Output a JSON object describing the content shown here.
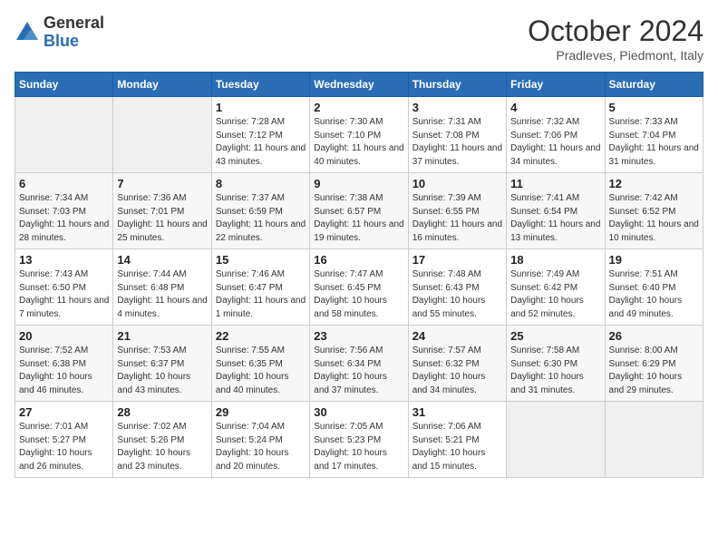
{
  "header": {
    "logo_general": "General",
    "logo_blue": "Blue",
    "month_title": "October 2024",
    "subtitle": "Pradleves, Piedmont, Italy"
  },
  "columns": [
    "Sunday",
    "Monday",
    "Tuesday",
    "Wednesday",
    "Thursday",
    "Friday",
    "Saturday"
  ],
  "weeks": [
    [
      {
        "day": "",
        "detail": ""
      },
      {
        "day": "",
        "detail": ""
      },
      {
        "day": "1",
        "detail": "Sunrise: 7:28 AM\nSunset: 7:12 PM\nDaylight: 11 hours and 43 minutes."
      },
      {
        "day": "2",
        "detail": "Sunrise: 7:30 AM\nSunset: 7:10 PM\nDaylight: 11 hours and 40 minutes."
      },
      {
        "day": "3",
        "detail": "Sunrise: 7:31 AM\nSunset: 7:08 PM\nDaylight: 11 hours and 37 minutes."
      },
      {
        "day": "4",
        "detail": "Sunrise: 7:32 AM\nSunset: 7:06 PM\nDaylight: 11 hours and 34 minutes."
      },
      {
        "day": "5",
        "detail": "Sunrise: 7:33 AM\nSunset: 7:04 PM\nDaylight: 11 hours and 31 minutes."
      }
    ],
    [
      {
        "day": "6",
        "detail": "Sunrise: 7:34 AM\nSunset: 7:03 PM\nDaylight: 11 hours and 28 minutes."
      },
      {
        "day": "7",
        "detail": "Sunrise: 7:36 AM\nSunset: 7:01 PM\nDaylight: 11 hours and 25 minutes."
      },
      {
        "day": "8",
        "detail": "Sunrise: 7:37 AM\nSunset: 6:59 PM\nDaylight: 11 hours and 22 minutes."
      },
      {
        "day": "9",
        "detail": "Sunrise: 7:38 AM\nSunset: 6:57 PM\nDaylight: 11 hours and 19 minutes."
      },
      {
        "day": "10",
        "detail": "Sunrise: 7:39 AM\nSunset: 6:55 PM\nDaylight: 11 hours and 16 minutes."
      },
      {
        "day": "11",
        "detail": "Sunrise: 7:41 AM\nSunset: 6:54 PM\nDaylight: 11 hours and 13 minutes."
      },
      {
        "day": "12",
        "detail": "Sunrise: 7:42 AM\nSunset: 6:52 PM\nDaylight: 11 hours and 10 minutes."
      }
    ],
    [
      {
        "day": "13",
        "detail": "Sunrise: 7:43 AM\nSunset: 6:50 PM\nDaylight: 11 hours and 7 minutes."
      },
      {
        "day": "14",
        "detail": "Sunrise: 7:44 AM\nSunset: 6:48 PM\nDaylight: 11 hours and 4 minutes."
      },
      {
        "day": "15",
        "detail": "Sunrise: 7:46 AM\nSunset: 6:47 PM\nDaylight: 11 hours and 1 minute."
      },
      {
        "day": "16",
        "detail": "Sunrise: 7:47 AM\nSunset: 6:45 PM\nDaylight: 10 hours and 58 minutes."
      },
      {
        "day": "17",
        "detail": "Sunrise: 7:48 AM\nSunset: 6:43 PM\nDaylight: 10 hours and 55 minutes."
      },
      {
        "day": "18",
        "detail": "Sunrise: 7:49 AM\nSunset: 6:42 PM\nDaylight: 10 hours and 52 minutes."
      },
      {
        "day": "19",
        "detail": "Sunrise: 7:51 AM\nSunset: 6:40 PM\nDaylight: 10 hours and 49 minutes."
      }
    ],
    [
      {
        "day": "20",
        "detail": "Sunrise: 7:52 AM\nSunset: 6:38 PM\nDaylight: 10 hours and 46 minutes."
      },
      {
        "day": "21",
        "detail": "Sunrise: 7:53 AM\nSunset: 6:37 PM\nDaylight: 10 hours and 43 minutes."
      },
      {
        "day": "22",
        "detail": "Sunrise: 7:55 AM\nSunset: 6:35 PM\nDaylight: 10 hours and 40 minutes."
      },
      {
        "day": "23",
        "detail": "Sunrise: 7:56 AM\nSunset: 6:34 PM\nDaylight: 10 hours and 37 minutes."
      },
      {
        "day": "24",
        "detail": "Sunrise: 7:57 AM\nSunset: 6:32 PM\nDaylight: 10 hours and 34 minutes."
      },
      {
        "day": "25",
        "detail": "Sunrise: 7:58 AM\nSunset: 6:30 PM\nDaylight: 10 hours and 31 minutes."
      },
      {
        "day": "26",
        "detail": "Sunrise: 8:00 AM\nSunset: 6:29 PM\nDaylight: 10 hours and 29 minutes."
      }
    ],
    [
      {
        "day": "27",
        "detail": "Sunrise: 7:01 AM\nSunset: 5:27 PM\nDaylight: 10 hours and 26 minutes."
      },
      {
        "day": "28",
        "detail": "Sunrise: 7:02 AM\nSunset: 5:26 PM\nDaylight: 10 hours and 23 minutes."
      },
      {
        "day": "29",
        "detail": "Sunrise: 7:04 AM\nSunset: 5:24 PM\nDaylight: 10 hours and 20 minutes."
      },
      {
        "day": "30",
        "detail": "Sunrise: 7:05 AM\nSunset: 5:23 PM\nDaylight: 10 hours and 17 minutes."
      },
      {
        "day": "31",
        "detail": "Sunrise: 7:06 AM\nSunset: 5:21 PM\nDaylight: 10 hours and 15 minutes."
      },
      {
        "day": "",
        "detail": ""
      },
      {
        "day": "",
        "detail": ""
      }
    ]
  ]
}
